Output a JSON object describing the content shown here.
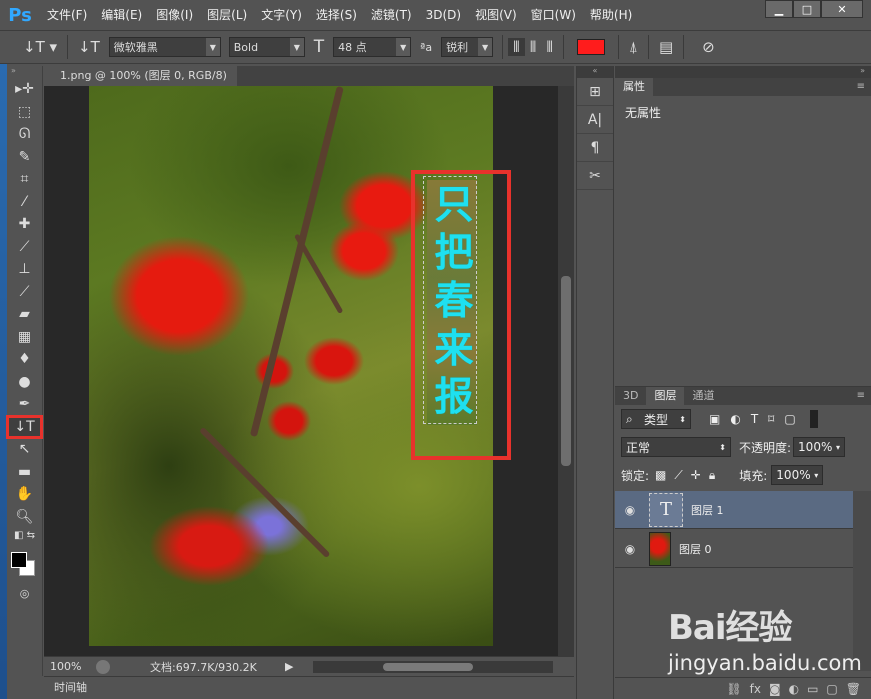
{
  "app": {
    "logo": "Ps"
  },
  "menu": [
    "文件(F)",
    "编辑(E)",
    "图像(I)",
    "图层(L)",
    "文字(Y)",
    "选择(S)",
    "滤镜(T)",
    "3D(D)",
    "视图(V)",
    "窗口(W)",
    "帮助(H)"
  ],
  "window_buttons": {
    "minimize": "▁",
    "maximize": "□",
    "close": "✕"
  },
  "options": {
    "font_family": "微软雅黑",
    "font_style": "Bold",
    "font_size": "48 点",
    "aa_label": "ªa",
    "antialias": "锐利",
    "text_color": "#ff1c1c"
  },
  "document": {
    "tab_title": "1.png @ 100% (图层 0, RGB/8)",
    "vertical_text": [
      "只",
      "把",
      "春",
      "来",
      "报"
    ],
    "text_color": "#1ee0f0"
  },
  "status": {
    "zoom": "100%",
    "doc_info": "文档:697.7K/930.2K"
  },
  "timeline_label": "时间轴",
  "properties": {
    "tab": "属性",
    "body": "无属性"
  },
  "layers_panel": {
    "tabs": [
      "3D",
      "图层",
      "通道"
    ],
    "filter_kind": "类型",
    "blend_mode": "正常",
    "opacity_label": "不透明度:",
    "opacity_value": "100%",
    "lock_label": "锁定:",
    "fill_label": "填充:",
    "fill_value": "100%",
    "layers": [
      {
        "name": "图层 1",
        "kind": "text",
        "selected": true
      },
      {
        "name": "图层 0",
        "kind": "image",
        "selected": false
      }
    ]
  },
  "watermark": {
    "logo": "Bai经验",
    "url": "jingyan.baidu.com"
  }
}
